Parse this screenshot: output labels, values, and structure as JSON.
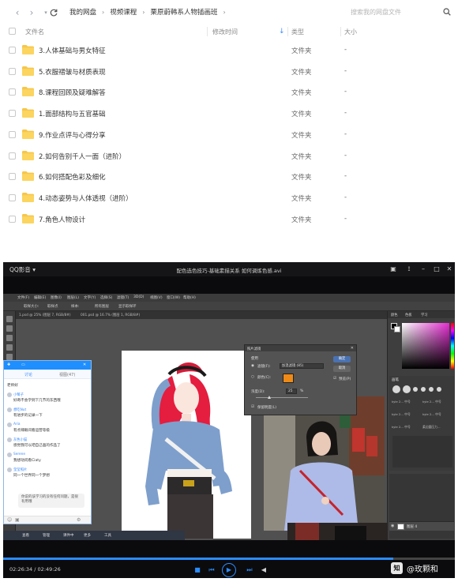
{
  "netdisk": {
    "breadcrumbs": [
      "我的网盘",
      "视频课程",
      "栗原蔚韩系人物插画班"
    ],
    "search_placeholder": "搜索我的网盘文件",
    "columns": {
      "name": "文件名",
      "modified": "修改时间",
      "type": "类型",
      "size": "大小"
    },
    "files": [
      {
        "name": "3.人体基础与男女特征",
        "type": "文件夹",
        "size": "-"
      },
      {
        "name": "5.衣服褶皱与材质表现",
        "type": "文件夹",
        "size": "-"
      },
      {
        "name": "8.课程回顾及疑难解答",
        "type": "文件夹",
        "size": "-"
      },
      {
        "name": "1.面部结构与五官基础",
        "type": "文件夹",
        "size": "-"
      },
      {
        "name": "9.作业点评与心得分享",
        "type": "文件夹",
        "size": "-"
      },
      {
        "name": "2.如何告别千人一面（进阶）",
        "type": "文件夹",
        "size": "-"
      },
      {
        "name": "6.如何搭配色彩及细化",
        "type": "文件夹",
        "size": "-"
      },
      {
        "name": "4.动态姿势与人体透视（进阶）",
        "type": "文件夹",
        "size": "-"
      },
      {
        "name": "7.角色人物设计",
        "type": "文件夹",
        "size": "-"
      }
    ],
    "folder_color": "#f7c64a",
    "accent": "#3d8bff"
  },
  "player": {
    "brand": "QQ影音 ▾",
    "title": "配色选色技巧-基础素描关系 如何调炼色感.avi",
    "current_time": "02:26:34",
    "total_time": "02:49:26",
    "progress": 0.864,
    "accent": "#2a8cff",
    "watermark": "@玫颗和",
    "watermark_logo": "知"
  },
  "photoshop": {
    "menus": [
      "文件(F)",
      "编辑(E)",
      "图像(I)",
      "图层(L)",
      "文字(Y)",
      "选择(S)",
      "滤镜(T)",
      "3D(D)",
      "视图(V)",
      "窗口(W)",
      "帮助(H)"
    ],
    "options": [
      "取样大小:",
      "取样点",
      "样本:",
      "所有图层",
      "显示取样环"
    ],
    "doc_tabs": [
      "1.psd @ 25% (图层 7, RGB/8#)",
      "001.psd @ 16.7% (图层 1, RGB/8#)"
    ],
    "panel_tabs": [
      "颜色",
      "色板",
      "学习"
    ],
    "dialog": {
      "title": "照片滤镜",
      "use_label": "使用",
      "filter_label": "滤镜(F):",
      "filter_value": "加温滤镜 (85)",
      "color_label": "颜色(C):",
      "density_label": "浓度(D):",
      "density_value": "25",
      "density_unit": "%",
      "preserve_label": "保留明度(L)",
      "ok": "确定",
      "cancel": "取消",
      "preview": "预览(P)",
      "swatch_color": "#ee8a17"
    },
    "brushes_tab": "画笔",
    "brush_names": [
      "kyle 2... 中号",
      "kyle 2... 中号",
      "kyle 2... 中号",
      "kyle 2... 中号",
      "kyle 2... 中号",
      "柔边圆压力..."
    ],
    "layer_name": "图层 4",
    "picker_hue": "#e52ed1"
  },
  "chat": {
    "tab_left": "讨论",
    "tab_right": "视图(47)",
    "messages": [
      {
        "name": "",
        "text": "老师好"
      },
      {
        "name": "小莓子",
        "text": "好奇不会学到下几节的东西哦"
      },
      {
        "name": "想吃Nut",
        "text": "有进步的记录一下"
      },
      {
        "name": "Aria",
        "text": "有点辣眼间看运营等级"
      },
      {
        "name": "灰色小猫",
        "text": "感觉我可以吧自己画的作品了"
      },
      {
        "name": "Serene",
        "text": "我想动问看Ciaty"
      },
      {
        "name": "莹莹照片",
        "text": "同一个世界同一个梦想"
      }
    ],
    "input_hint": "你说的该学习的没有任何问题，是很有用哦",
    "taskbar": [
      "查看",
      "管理",
      "课件中",
      "更多",
      "工具"
    ]
  }
}
